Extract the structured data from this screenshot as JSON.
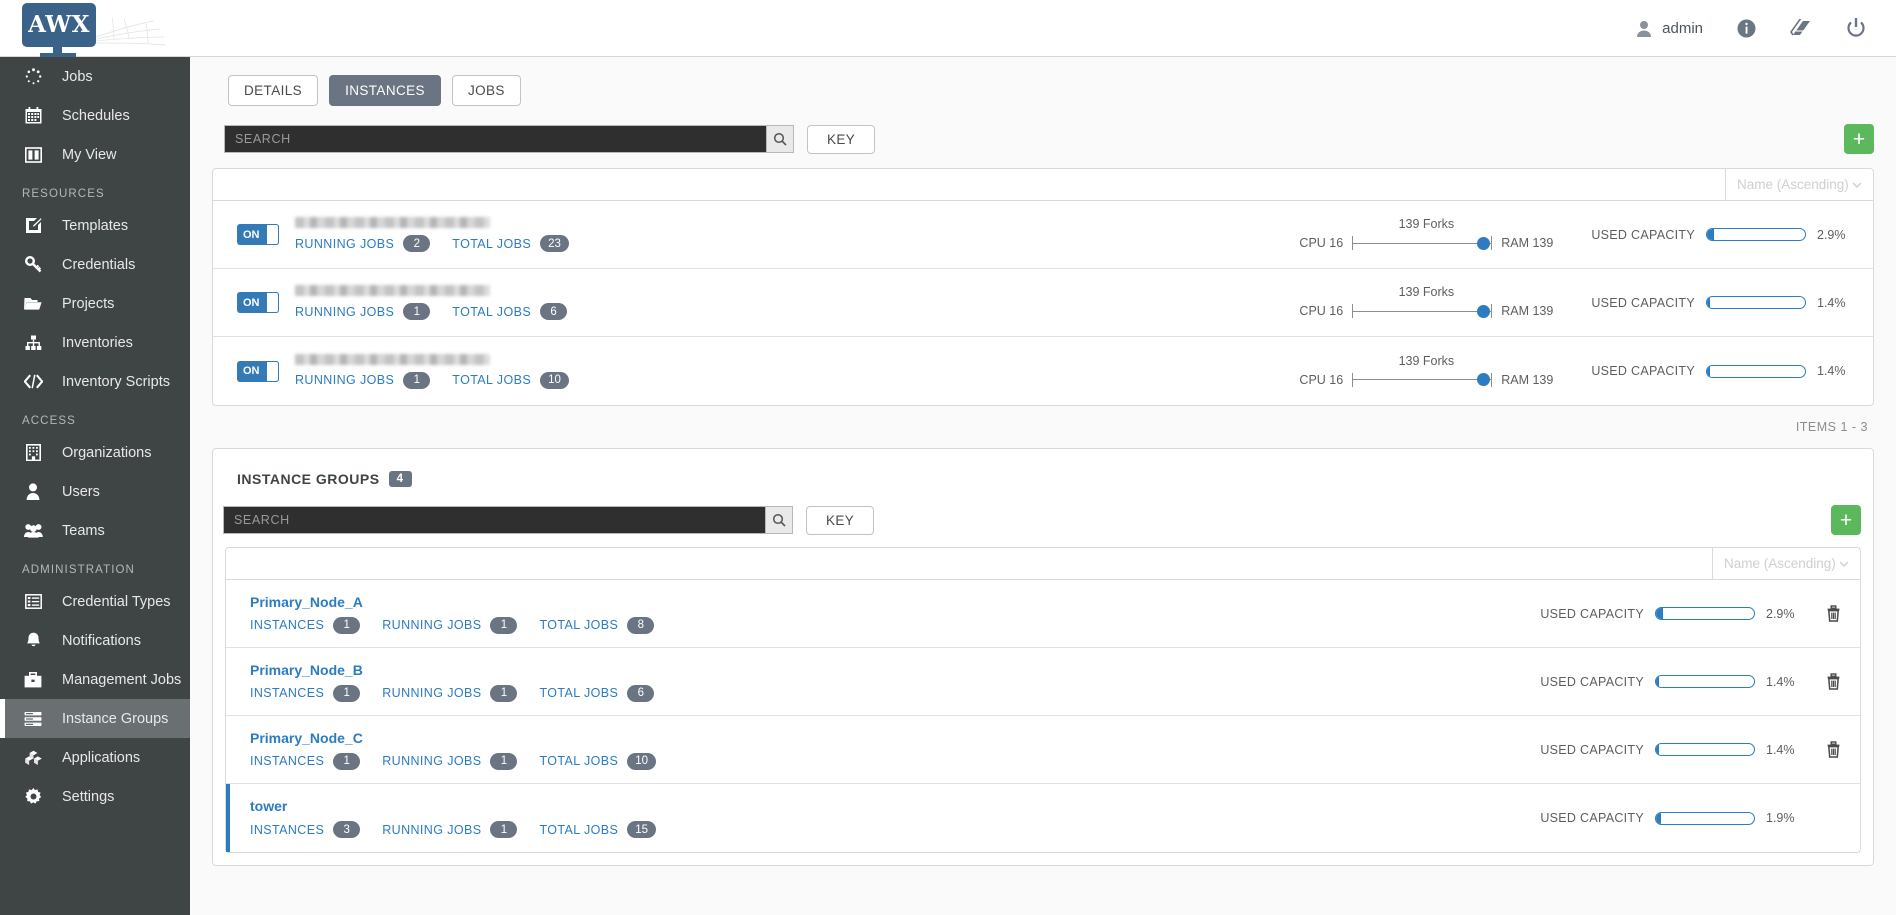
{
  "header": {
    "logo_text": "AWX",
    "user_label": "admin",
    "icons": [
      "user-icon",
      "info-icon",
      "book-icon",
      "power-icon"
    ]
  },
  "sidebar": {
    "items": [
      {
        "label": "Jobs",
        "icon": "jobs-spinner-icon",
        "active": false
      },
      {
        "label": "Schedules",
        "icon": "calendar-icon",
        "active": false
      },
      {
        "label": "My View",
        "icon": "columns-icon",
        "active": false
      }
    ],
    "sections": [
      {
        "title": "RESOURCES",
        "items": [
          {
            "label": "Templates",
            "icon": "pencil-square-icon",
            "active": false
          },
          {
            "label": "Credentials",
            "icon": "key-icon",
            "active": false
          },
          {
            "label": "Projects",
            "icon": "folder-icon",
            "active": false
          },
          {
            "label": "Inventories",
            "icon": "sitemap-icon",
            "active": false
          },
          {
            "label": "Inventory Scripts",
            "icon": "code-icon",
            "active": false
          }
        ]
      },
      {
        "title": "ACCESS",
        "items": [
          {
            "label": "Organizations",
            "icon": "building-icon",
            "active": false
          },
          {
            "label": "Users",
            "icon": "user-icon",
            "active": false
          },
          {
            "label": "Teams",
            "icon": "users-icon",
            "active": false
          }
        ]
      },
      {
        "title": "ADMINISTRATION",
        "items": [
          {
            "label": "Credential Types",
            "icon": "list-icon",
            "active": false
          },
          {
            "label": "Notifications",
            "icon": "bell-icon",
            "active": false
          },
          {
            "label": "Management Jobs",
            "icon": "briefcase-icon",
            "active": false
          },
          {
            "label": "Instance Groups",
            "icon": "server-stack-icon",
            "active": true
          },
          {
            "label": "Applications",
            "icon": "cubes-icon",
            "active": false
          },
          {
            "label": "Settings",
            "icon": "gear-icon",
            "active": false
          }
        ]
      }
    ]
  },
  "tabs": [
    {
      "label": "DETAILS",
      "active": false
    },
    {
      "label": "INSTANCES",
      "active": true
    },
    {
      "label": "JOBS",
      "active": false
    }
  ],
  "instances_panel": {
    "search_placeholder": "SEARCH",
    "search_value": "",
    "key_label": "KEY",
    "add_label": "+",
    "sort_label": "Name (Ascending)",
    "items_footer": "ITEMS 1 - 3",
    "rows": [
      {
        "toggle_state": "ON",
        "name_redacted": true,
        "running_jobs_label": "RUNNING JOBS",
        "running_jobs": "2",
        "total_jobs_label": "TOTAL JOBS",
        "total_jobs": "23",
        "forks_label": "139 Forks",
        "cpu_label": "CPU 16",
        "ram_label": "RAM 139",
        "capacity_label": "USED CAPACITY",
        "capacity_pct": "2.9%",
        "capacity_value": 7
      },
      {
        "toggle_state": "ON",
        "name_redacted": true,
        "running_jobs_label": "RUNNING JOBS",
        "running_jobs": "1",
        "total_jobs_label": "TOTAL JOBS",
        "total_jobs": "6",
        "forks_label": "139 Forks",
        "cpu_label": "CPU 16",
        "ram_label": "RAM 139",
        "capacity_label": "USED CAPACITY",
        "capacity_pct": "1.4%",
        "capacity_value": 3
      },
      {
        "toggle_state": "ON",
        "name_redacted": true,
        "running_jobs_label": "RUNNING JOBS",
        "running_jobs": "1",
        "total_jobs_label": "TOTAL JOBS",
        "total_jobs": "10",
        "forks_label": "139 Forks",
        "cpu_label": "CPU 16",
        "ram_label": "RAM 139",
        "capacity_label": "USED CAPACITY",
        "capacity_pct": "1.4%",
        "capacity_value": 3
      }
    ]
  },
  "groups_panel": {
    "title": "INSTANCE GROUPS",
    "count": "4",
    "search_placeholder": "SEARCH",
    "search_value": "",
    "key_label": "KEY",
    "add_label": "+",
    "sort_label": "Name (Ascending)",
    "rows": [
      {
        "name": "Primary_Node_A",
        "instances_label": "INSTANCES",
        "instances": "1",
        "running_jobs_label": "RUNNING JOBS",
        "running_jobs": "1",
        "total_jobs_label": "TOTAL JOBS",
        "total_jobs": "8",
        "capacity_label": "USED CAPACITY",
        "capacity_pct": "2.9%",
        "capacity_value": 7,
        "deletable": true,
        "selected": false
      },
      {
        "name": "Primary_Node_B",
        "instances_label": "INSTANCES",
        "instances": "1",
        "running_jobs_label": "RUNNING JOBS",
        "running_jobs": "1",
        "total_jobs_label": "TOTAL JOBS",
        "total_jobs": "6",
        "capacity_label": "USED CAPACITY",
        "capacity_pct": "1.4%",
        "capacity_value": 3,
        "deletable": true,
        "selected": false
      },
      {
        "name": "Primary_Node_C",
        "instances_label": "INSTANCES",
        "instances": "1",
        "running_jobs_label": "RUNNING JOBS",
        "running_jobs": "1",
        "total_jobs_label": "TOTAL JOBS",
        "total_jobs": "10",
        "capacity_label": "USED CAPACITY",
        "capacity_pct": "1.4%",
        "capacity_value": 3,
        "deletable": true,
        "selected": false
      },
      {
        "name": "tower",
        "instances_label": "INSTANCES",
        "instances": "3",
        "running_jobs_label": "RUNNING JOBS",
        "running_jobs": "1",
        "total_jobs_label": "TOTAL JOBS",
        "total_jobs": "15",
        "capacity_label": "USED CAPACITY",
        "capacity_pct": "1.9%",
        "capacity_value": 5,
        "deletable": false,
        "selected": true
      }
    ]
  },
  "colors": {
    "accent_blue": "#2b7cc1",
    "toggle_blue": "#337ab7",
    "add_green": "#5cb85c",
    "sidebar_bg": "#3f4445",
    "tab_active": "#6b7482"
  }
}
